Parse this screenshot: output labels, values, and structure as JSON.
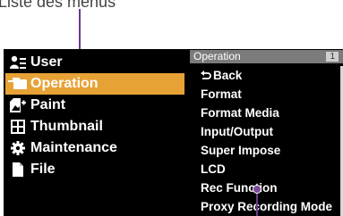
{
  "caption": "Liste des menus",
  "menu": {
    "items": [
      {
        "label": "User",
        "icon": "user-icon"
      },
      {
        "label": "Operation",
        "icon": "camera-icon",
        "selected": true
      },
      {
        "label": "Paint",
        "icon": "paint-icon"
      },
      {
        "label": "Thumbnail",
        "icon": "thumbnail-icon"
      },
      {
        "label": "Maintenance",
        "icon": "gear-icon"
      },
      {
        "label": "File",
        "icon": "file-icon"
      }
    ]
  },
  "submenu": {
    "title": "Operation",
    "page": "1",
    "back_label": "Back",
    "items": [
      "Format",
      "Format Media",
      "Input/Output",
      "Super Impose",
      "LCD",
      "Rec Function",
      "Proxy Recording Mode"
    ]
  },
  "colors": {
    "selected": "#e7a235",
    "callout": "#6b3a88",
    "header": "#7b7b7b"
  }
}
